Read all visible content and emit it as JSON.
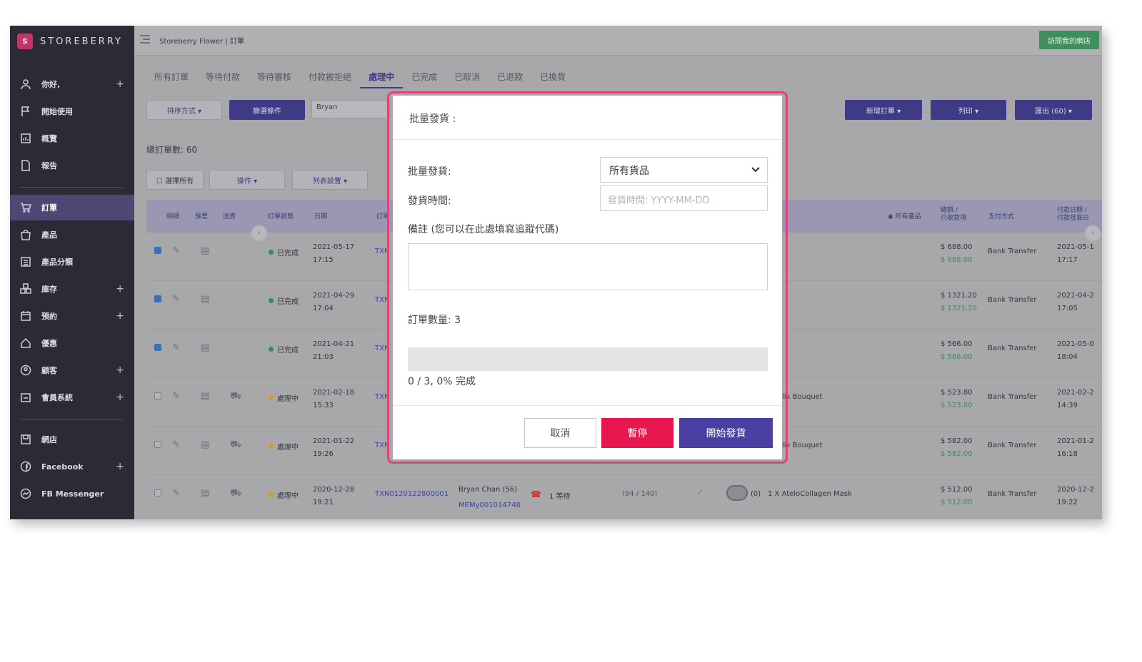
{
  "sidebar": {
    "brand": "STOREBERRY",
    "items": [
      {
        "label": "你好,",
        "plus": "+"
      },
      {
        "label": "開始使用",
        "plus": ""
      },
      {
        "label": "概覽",
        "plus": ""
      },
      {
        "label": "報告",
        "plus": ""
      },
      {
        "label": "訂單",
        "plus": ""
      },
      {
        "label": "產品",
        "plus": ""
      },
      {
        "label": "產品分類",
        "plus": ""
      },
      {
        "label": "庫存",
        "plus": "+"
      },
      {
        "label": "預約",
        "plus": "+"
      },
      {
        "label": "優惠",
        "plus": ""
      },
      {
        "label": "顧客",
        "plus": "+"
      },
      {
        "label": "會員系統",
        "plus": "+"
      },
      {
        "label": "網店",
        "plus": ""
      },
      {
        "label": "Facebook",
        "plus": "+"
      },
      {
        "label": "FB Messenger",
        "plus": ""
      }
    ]
  },
  "topbar": {
    "breadcrumb": "Storeberry Flower  |  訂單",
    "visit_label": "訪問我的網店"
  },
  "tabs": [
    "所有訂單",
    "等待付款",
    "等待審核",
    "付款被拒絕",
    "處理中",
    "已完成",
    "已取消",
    "已退款",
    "已換貨"
  ],
  "toolbar": {
    "sort_label": "排序方式 ▾",
    "filter_label": "篩選條件",
    "search_value": "Bryan",
    "new_order_label": "新增訂單 ▾",
    "print_label": "列印 ▾",
    "export_label": "匯出 (60) ▾",
    "total_label": "總訂單數: 60",
    "select_all_label": "☐ 選擇所有",
    "actions_label": "操作 ▾",
    "list_settings_label": "列表設置 ▾"
  },
  "table": {
    "headers": {
      "detail": "明細",
      "invoice": "發票",
      "shipping": "送貨",
      "status": "訂單狀態",
      "date": "日期",
      "order_no": "訂單",
      "all_products": "所有產品",
      "total_line1": "總額 /",
      "total_line2": "已收款項",
      "payment": "支付方式",
      "paid_line1": "付款日期 /",
      "paid_line2": "付款批准日"
    },
    "rows": [
      {
        "checked": true,
        "status": "已完成",
        "status_color": "green",
        "date": "2021-05-17",
        "time": "17:15",
        "order": "TXN",
        "product": "",
        "total": "$ 688.00",
        "received": "$ 688.00",
        "payment": "Bank Transfer",
        "paid_date": "2021-05-1",
        "paid_time": "17:17"
      },
      {
        "checked": true,
        "status": "已完成",
        "status_color": "green",
        "date": "2021-04-29",
        "time": "17:04",
        "order": "TXN",
        "product": "",
        "total": "$ 1321.20",
        "received": "$ 1321.20",
        "payment": "Bank Transfer",
        "paid_date": "2021-04-2",
        "paid_time": "17:05"
      },
      {
        "checked": true,
        "status": "已完成",
        "status_color": "green",
        "date": "2021-04-21",
        "time": "21:03",
        "order": "TXN",
        "product": "",
        "total": "$ 566.00",
        "received": "$ 566.00",
        "payment": "Bank Transfer",
        "paid_date": "2021-05-0",
        "paid_time": "18:04"
      },
      {
        "checked": false,
        "status": "處理中",
        "status_color": "orange",
        "date": "2021-02-18",
        "time": "15:33",
        "order": "TXN",
        "product": "lix Bouquet",
        "total": "$ 523.80",
        "received": "$ 523.80",
        "payment": "Bank Transfer",
        "paid_date": "2021-02-2",
        "paid_time": "14:39"
      },
      {
        "checked": false,
        "status": "處理中",
        "status_color": "orange",
        "date": "2021-01-22",
        "time": "19:26",
        "order": "TXN",
        "product": "lix Bouquet",
        "total": "$ 582.00",
        "received": "$ 582.00",
        "payment": "Bank Transfer",
        "paid_date": "2021-01-2",
        "paid_time": "16:18"
      },
      {
        "checked": false,
        "status": "處理中",
        "status_color": "orange",
        "date": "2020-12-28",
        "time": "19:21",
        "order": "TXN0120122800001",
        "customer": "Bryan Chan (56)",
        "member": "MEMy001014748",
        "waiting": "1 等待",
        "points": "(94 / 140)",
        "count": "(0)",
        "product": "1 X AteloCollagen Mask",
        "total": "$ 512.00",
        "received": "$ 512.00",
        "payment": "Bank Transfer",
        "paid_date": "2020-12-2",
        "paid_time": "19:22"
      }
    ]
  },
  "modal": {
    "title": "批量發貨 :",
    "ship_label": "批量發貨:",
    "ship_value": "所有貨品",
    "time_label": "發貨時間:",
    "time_placeholder": "發貨時間: YYYY-MM-DD",
    "note_label": "備註 (您可以在此處填寫追蹤代碼)",
    "order_count_label": "訂單數量: 3",
    "progress_text": "0 / 3, 0% 完成",
    "progress_fraction": 0,
    "cancel_label": "取消",
    "pause_label": "暫停",
    "start_label": "開始發貨",
    "colors": {
      "pause": "#e8174f",
      "start": "#4a3fa3",
      "accent_border": "#e04378"
    }
  }
}
